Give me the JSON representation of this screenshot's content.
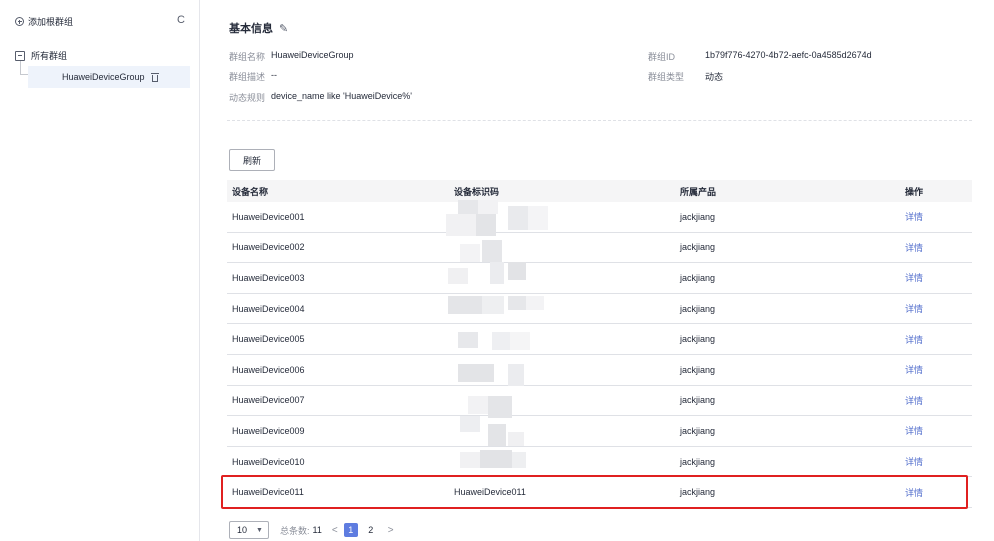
{
  "sidebar": {
    "add_label": "添加根群组",
    "refresh_glyph": "C",
    "root_label": "所有群组",
    "child_label": "HuaweiDeviceGroup"
  },
  "info": {
    "title": "基本信息",
    "name_label": "群组名称",
    "name_value": "HuaweiDeviceGroup",
    "desc_label": "群组描述",
    "desc_value": "--",
    "rule_label": "动态规则",
    "rule_value": "device_name like 'HuaweiDevice%'",
    "id_label": "群组ID",
    "id_value": "1b79f776-4270-4b72-aefc-0a4585d2674d",
    "type_label": "群组类型",
    "type_value": "动态"
  },
  "toolbar": {
    "refresh_label": "刷新"
  },
  "table": {
    "headers": [
      "设备名称",
      "设备标识码",
      "所属产品",
      "操作"
    ],
    "rows": [
      {
        "name": "HuaweiDevice001",
        "id": "",
        "product": "jackjiang",
        "action": "详情"
      },
      {
        "name": "HuaweiDevice002",
        "id": "",
        "product": "jackjiang",
        "action": "详情"
      },
      {
        "name": "HuaweiDevice003",
        "id": "",
        "product": "jackjiang",
        "action": "详情"
      },
      {
        "name": "HuaweiDevice004",
        "id": "",
        "product": "jackjiang",
        "action": "详情"
      },
      {
        "name": "HuaweiDevice005",
        "id": "",
        "product": "jackjiang",
        "action": "详情"
      },
      {
        "name": "HuaweiDevice006",
        "id": "",
        "product": "jackjiang",
        "action": "详情"
      },
      {
        "name": "HuaweiDevice007",
        "id": "",
        "product": "jackjiang",
        "action": "详情"
      },
      {
        "name": "HuaweiDevice009",
        "id": "",
        "product": "jackjiang",
        "action": "详情"
      },
      {
        "name": "HuaweiDevice010",
        "id": "",
        "product": "jackjiang",
        "action": "详情"
      },
      {
        "name": "HuaweiDevice011",
        "id": "HuaweiDevice011",
        "product": "jackjiang",
        "action": "详情"
      }
    ]
  },
  "pagination": {
    "page_size": "10",
    "total_label": "总条数:",
    "total_value": "11",
    "prev_glyph": "<",
    "next_glyph": ">",
    "pages": [
      "1",
      "2"
    ],
    "current_page": "1"
  },
  "colors": {
    "accent": "#5e7ce0",
    "link": "#526ecc",
    "highlight_border": "#e02020"
  }
}
